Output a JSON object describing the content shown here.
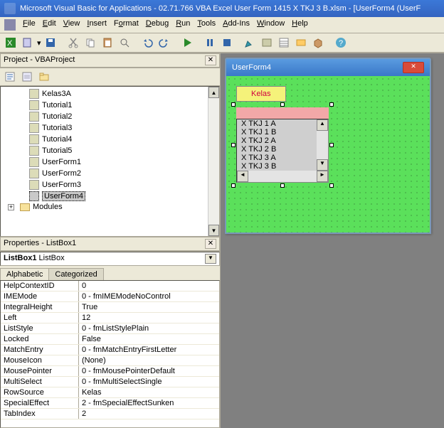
{
  "title": "Microsoft Visual Basic for Applications - 02.71.766 VBA Excel User Form 1415 X TKJ 3 B.xlsm - [UserForm4 (UserF",
  "menus": {
    "file": "File",
    "edit": "Edit",
    "view": "View",
    "insert": "Insert",
    "format": "Format",
    "debug": "Debug",
    "run": "Run",
    "tools": "Tools",
    "addins": "Add-Ins",
    "window": "Window",
    "help": "Help"
  },
  "project": {
    "title": "Project - VBAProject",
    "items": [
      "Kelas3A",
      "Tutorial1",
      "Tutorial2",
      "Tutorial3",
      "Tutorial4",
      "Tutorial5",
      "UserForm1",
      "UserForm2",
      "UserForm3",
      "UserForm4"
    ],
    "selected_index": 9,
    "folder": "Modules"
  },
  "properties": {
    "title": "Properties - ListBox1",
    "object_name": "ListBox1",
    "object_type": "ListBox",
    "tabs": [
      "Alphabetic",
      "Categorized"
    ],
    "rows": [
      {
        "name": "HelpContextID",
        "val": "0"
      },
      {
        "name": "IMEMode",
        "val": "0 - fmIMEModeNoControl"
      },
      {
        "name": "IntegralHeight",
        "val": "True"
      },
      {
        "name": "Left",
        "val": "12"
      },
      {
        "name": "ListStyle",
        "val": "0 - fmListStylePlain"
      },
      {
        "name": "Locked",
        "val": "False"
      },
      {
        "name": "MatchEntry",
        "val": "0 - fmMatchEntryFirstLetter"
      },
      {
        "name": "MouseIcon",
        "val": "(None)"
      },
      {
        "name": "MousePointer",
        "val": "0 - fmMousePointerDefault"
      },
      {
        "name": "MultiSelect",
        "val": "0 - fmMultiSelectSingle"
      },
      {
        "name": "RowSource",
        "val": "Kelas"
      },
      {
        "name": "SpecialEffect",
        "val": "2 - fmSpecialEffectSunken"
      },
      {
        "name": "TabIndex",
        "val": "2"
      }
    ]
  },
  "form": {
    "title": "UserForm4",
    "label": "Kelas",
    "listbox_items": [
      "X TKJ 1 A",
      "X TKJ 1 B",
      "X TKJ 2 A",
      "X TKJ 2 B",
      "X TKJ 3 A",
      "X TKJ 3 B"
    ]
  }
}
